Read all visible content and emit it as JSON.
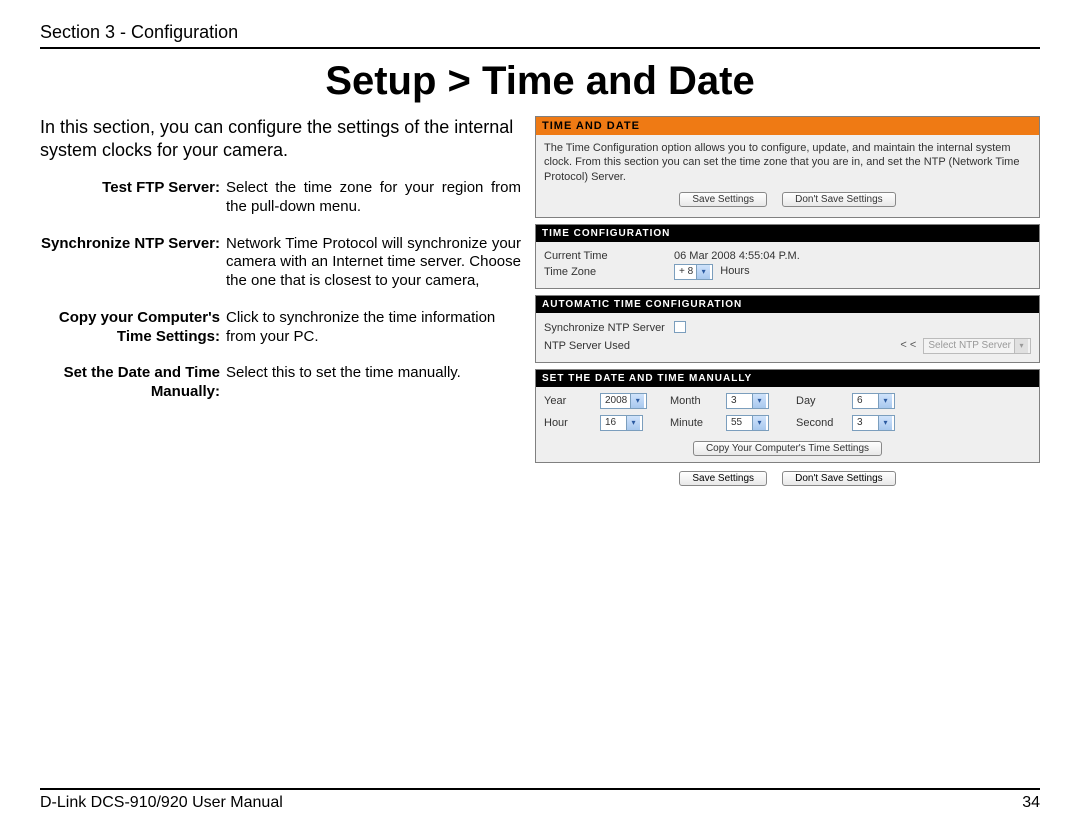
{
  "header": {
    "section": "Section 3 - Configuration"
  },
  "title": "Setup > Time and Date",
  "intro": "In this section, you can configure the settings of the internal system clocks for your camera.",
  "defs": [
    {
      "label": "Test FTP Server:",
      "val": "Select the time zone for your region from the pull-down menu."
    },
    {
      "label": "Synchronize NTP Server:",
      "val": "Network Time Protocol will synchronize your camera with an Internet time server. Choose the one that is closest to your camera,"
    },
    {
      "label": "Copy your Computer's Time Settings:",
      "val": "Click to synchronize the time information from your PC."
    },
    {
      "label": "Set the Date and Time Manually:",
      "val": "Select this to set the time manually."
    }
  ],
  "ui": {
    "timeDate": {
      "title": "TIME AND DATE",
      "desc": "The Time Configuration option allows you to configure, update, and maintain the internal system clock. From this section you can set the time zone that you are in, and set the NTP (Network Time Protocol) Server.",
      "save": "Save Settings",
      "dontSave": "Don't Save Settings"
    },
    "timeConfig": {
      "title": "TIME CONFIGURATION",
      "currentTimeLabel": "Current Time",
      "currentTime": "06 Mar 2008 4:55:04 P.M.",
      "timeZoneLabel": "Time Zone",
      "timeZone": "+ 8",
      "hours": "Hours"
    },
    "autoConfig": {
      "title": "AUTOMATIC TIME CONFIGURATION",
      "syncLabel": "Synchronize NTP Server",
      "ntpUsedLabel": "NTP Server Used",
      "arrows": "< <",
      "ntpPlaceholder": "Select NTP Server"
    },
    "manual": {
      "title": "SET THE DATE AND TIME MANUALLY",
      "yearLabel": "Year",
      "year": "2008",
      "monthLabel": "Month",
      "month": "3",
      "dayLabel": "Day",
      "day": "6",
      "hourLabel": "Hour",
      "hour": "16",
      "minuteLabel": "Minute",
      "minute": "55",
      "secondLabel": "Second",
      "second": "3",
      "copyBtn": "Copy Your Computer's Time Settings"
    },
    "bottom": {
      "save": "Save Settings",
      "dontSave": "Don't Save Settings"
    }
  },
  "footer": {
    "left": "D-Link DCS-910/920 User Manual",
    "right": "34"
  }
}
